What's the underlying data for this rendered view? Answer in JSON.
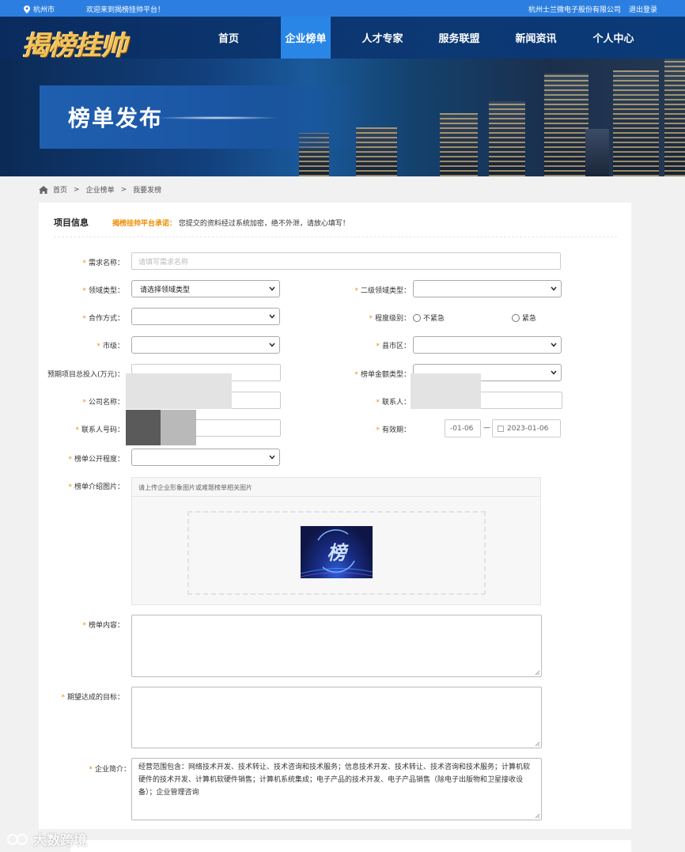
{
  "topbar": {
    "city": "杭州市",
    "welcome": "欢迎来到揭榜挂帅平台！",
    "company": "杭州士兰微电子股份有限公司",
    "logout": "退出登录"
  },
  "brand": {
    "logo_text": "揭榜挂帅"
  },
  "nav": {
    "items": [
      {
        "label": "首页"
      },
      {
        "label": "企业榜单"
      },
      {
        "label": "人才专家"
      },
      {
        "label": "服务联盟"
      },
      {
        "label": "新闻资讯"
      },
      {
        "label": "个人中心"
      }
    ],
    "active": "企业榜单"
  },
  "banner": {
    "title": "榜单发布"
  },
  "breadcrumb": {
    "items": [
      "首页",
      ">",
      "企业榜单",
      ">",
      "我要发榜"
    ]
  },
  "section": {
    "title": "项目信息",
    "promise_label": "揭榜挂帅平台承诺：",
    "promise_text": "您提交的资料经过系统加密，绝不外泄，请放心填写！"
  },
  "form": {
    "demand_name": {
      "label": "需求名称：",
      "placeholder": "请填写需求名称",
      "value": ""
    },
    "domain_type": {
      "label": "领域类型：",
      "selected": "请选择领域类型"
    },
    "sub_domain_type": {
      "label": "二级领域类型：",
      "selected": ""
    },
    "cooperation": {
      "label": "合作方式：",
      "selected": ""
    },
    "urgency": {
      "label": "程度级别：",
      "options": [
        "不紧急",
        "紧急"
      ]
    },
    "city_level": {
      "label": "市级：",
      "selected": ""
    },
    "county": {
      "label": "县市区：",
      "selected": ""
    },
    "investment": {
      "label": "预期项目总投入(万元)：",
      "value": ""
    },
    "amount_type": {
      "label": "榜单金额类型：",
      "selected": ""
    },
    "company_name": {
      "label": "公司名称：",
      "value": ""
    },
    "contact": {
      "label": "联系人：",
      "value": ""
    },
    "contact_phone": {
      "label": "联系人号码：",
      "value": ""
    },
    "validity": {
      "label": "有效期：",
      "start": "-01-06",
      "separator": "—",
      "end": "2023-01-06"
    },
    "openness": {
      "label": "榜单公开程度：",
      "selected": ""
    },
    "intro_image": {
      "label": "榜单介绍图片：",
      "hint": "请上传企业形象图片或难题榜单相关图片",
      "thumb_glyph": "榜"
    },
    "content": {
      "label": "榜单内容：",
      "value": ""
    },
    "goal": {
      "label": "期望达成的目标：",
      "value": ""
    },
    "company_intro": {
      "label": "企业简介：",
      "value": "经营范围包含：网络技术开发、技术转让、技术咨询和技术服务；信息技术开发、技术转让、技术咨询和技术服务；计算机软硬件的技术开发、计算机软硬件销售；计算机系统集成；电子产品的技术开发、电子产品销售（除电子出版物和卫星接收设备）；企业管理咨询"
    }
  },
  "watermark": {
    "text": "大数跨境"
  },
  "colors": {
    "topbar": "#2c7fe0",
    "nav_active": "#2a86e6",
    "required_star": "#f08c00",
    "promise_label": "#f08c00"
  }
}
